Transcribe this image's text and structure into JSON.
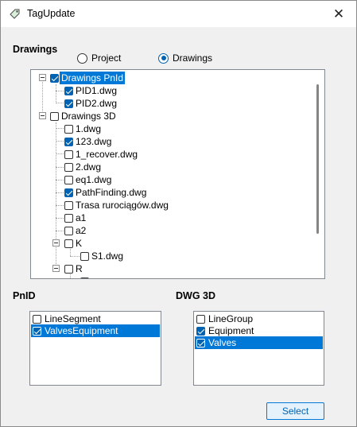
{
  "window": {
    "title": "TagUpdate",
    "close": "✕"
  },
  "drawings_section": {
    "label": "Drawings",
    "radio_project": "Project",
    "radio_drawings": "Drawings",
    "selected": "Drawings"
  },
  "tree": {
    "items": [
      {
        "label": "Drawings PnId",
        "checked": true,
        "selected": true
      },
      {
        "label": "PID1.dwg",
        "checked": true
      },
      {
        "label": "PID2.dwg",
        "checked": true
      },
      {
        "label": "Drawings 3D",
        "checked": false
      },
      {
        "label": "1.dwg",
        "checked": false
      },
      {
        "label": "123.dwg",
        "checked": true
      },
      {
        "label": "1_recover.dwg",
        "checked": false
      },
      {
        "label": "2.dwg",
        "checked": false
      },
      {
        "label": "eq1.dwg",
        "checked": false
      },
      {
        "label": "PathFinding.dwg",
        "checked": true
      },
      {
        "label": "Trasa rurociągów.dwg",
        "checked": false
      },
      {
        "label": "a1",
        "checked": false
      },
      {
        "label": "a2",
        "checked": false
      },
      {
        "label": "K",
        "checked": false
      },
      {
        "label": "S1.dwg",
        "checked": false
      },
      {
        "label": "R",
        "checked": false
      }
    ]
  },
  "pnid_section": {
    "label": "PnID",
    "items": [
      {
        "label": "LineSegment",
        "checked": false,
        "selected": false
      },
      {
        "label": "ValvesEquipment",
        "checked": true,
        "selected": true
      }
    ]
  },
  "dwg3d_section": {
    "label": "DWG 3D",
    "items": [
      {
        "label": "LineGroup",
        "checked": false,
        "selected": false
      },
      {
        "label": "Equipment",
        "checked": true,
        "selected": false
      },
      {
        "label": "Valves",
        "checked": true,
        "selected": true
      }
    ]
  },
  "buttons": {
    "select": "Select"
  }
}
